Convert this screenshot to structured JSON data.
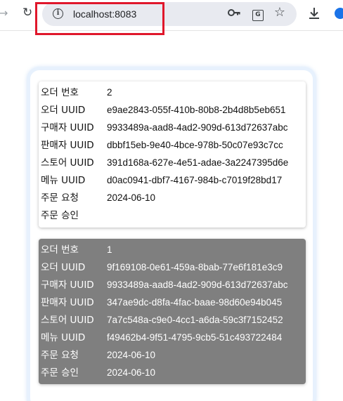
{
  "browser": {
    "url": "localhost:8083",
    "icons": {
      "forward": "forward-arrow-icon",
      "reload": "reload-icon",
      "site_info": "info-icon",
      "password": "key-icon",
      "translate": "translate-icon",
      "bookmark": "star-icon",
      "download": "download-icon",
      "profile": "avatar"
    }
  },
  "annotation_color": "#e0172b",
  "labels": {
    "order_no": "오더 번호",
    "order_uuid": "오더 UUID",
    "buyer_uuid": "구매자 UUID",
    "seller_uuid": "판매자 UUID",
    "store_uuid": "스토어 UUID",
    "menu_uuid": "메뉴 UUID",
    "order_requested": "주문 요청",
    "order_approved": "주문 승인"
  },
  "orders": [
    {
      "order_no": "2",
      "order_uuid": "e9ae2843-055f-410b-80b8-2b4d8b5eb651",
      "buyer_uuid": "9933489a-aad8-4ad2-909d-613d72637abc",
      "seller_uuid": "dbbf15eb-9e40-4bce-978b-50c07e93c7cc",
      "store_uuid": "391d168a-627e-4e51-adae-3a2247395d6e",
      "menu_uuid": "d0ac0941-dbf7-4167-984b-c7019f28bd17",
      "order_requested": "2024-06-10",
      "order_approved": "",
      "card_color": "#ffffff"
    },
    {
      "order_no": "1",
      "order_uuid": "9f169108-0e61-459a-8bab-77e6f181e3c9",
      "buyer_uuid": "9933489a-aad8-4ad2-909d-613d72637abc",
      "seller_uuid": "347ae9dc-d8fa-4fac-baae-98d60e94b045",
      "store_uuid": "7a7c548a-c9e0-4cc1-a6da-59c3f7152452",
      "menu_uuid": "f49462b4-9f51-4795-9cb5-51c493722484",
      "order_requested": "2024-06-10",
      "order_approved": "2024-06-10",
      "card_color": "#7f7f7f"
    }
  ]
}
